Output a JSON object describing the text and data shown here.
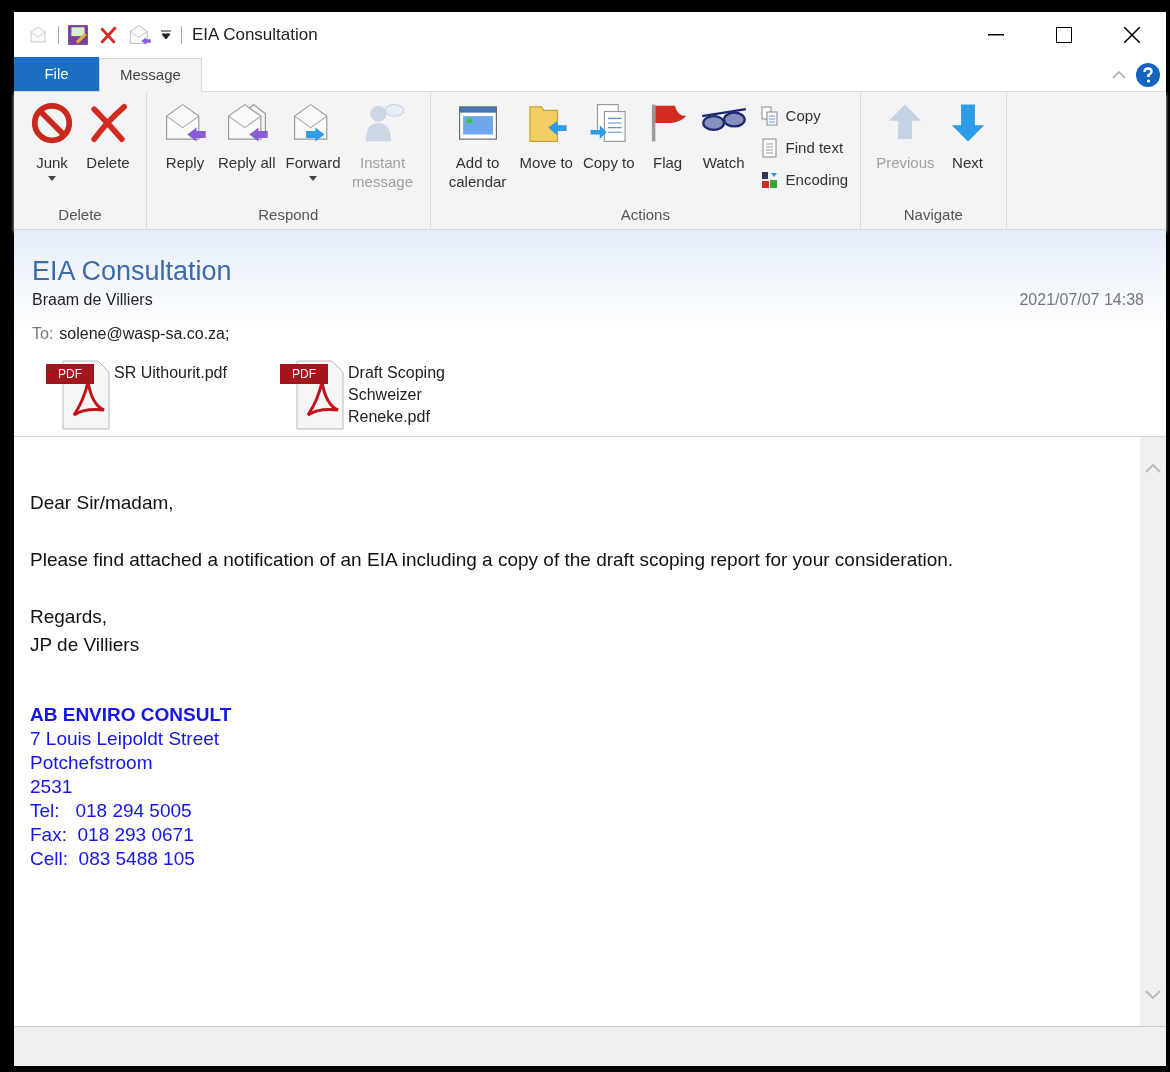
{
  "window": {
    "title": "EIA Consultation"
  },
  "tabs": [
    {
      "label": "File",
      "selected": false,
      "kind": "file"
    },
    {
      "label": "Message",
      "selected": true,
      "kind": "tab"
    }
  ],
  "ribbon": {
    "groups": [
      {
        "label": "Delete",
        "items": [
          {
            "kind": "large",
            "label": "Junk",
            "dropdown": true,
            "disabled": false
          },
          {
            "kind": "large",
            "label": "Delete",
            "dropdown": false,
            "disabled": false
          }
        ]
      },
      {
        "label": "Respond",
        "items": [
          {
            "kind": "large",
            "label": "Reply",
            "dropdown": false,
            "disabled": false
          },
          {
            "kind": "large",
            "label": "Reply all",
            "dropdown": false,
            "disabled": false
          },
          {
            "kind": "large",
            "label": "Forward",
            "dropdown": true,
            "disabled": false
          },
          {
            "kind": "large",
            "label": "Instant message",
            "dropdown": false,
            "disabled": true
          }
        ]
      },
      {
        "label": "Actions",
        "items": [
          {
            "kind": "large",
            "label": "Add to calendar",
            "dropdown": false,
            "disabled": false
          },
          {
            "kind": "large",
            "label": "Move to",
            "dropdown": false,
            "disabled": false
          },
          {
            "kind": "large",
            "label": "Copy to",
            "dropdown": false,
            "disabled": false
          },
          {
            "kind": "large",
            "label": "Flag",
            "dropdown": false,
            "disabled": false
          },
          {
            "kind": "large",
            "label": "Watch",
            "dropdown": false,
            "disabled": false
          },
          {
            "kind": "stack",
            "items": [
              {
                "label": "Copy",
                "disabled": false
              },
              {
                "label": "Find text",
                "disabled": false
              },
              {
                "label": "Encoding",
                "disabled": false
              }
            ]
          }
        ]
      },
      {
        "label": "Navigate",
        "items": [
          {
            "kind": "large",
            "label": "Previous",
            "dropdown": false,
            "disabled": true
          },
          {
            "kind": "large",
            "label": "Next",
            "dropdown": false,
            "disabled": false
          }
        ]
      }
    ]
  },
  "message": {
    "subject": "EIA Consultation",
    "sender": "Braam de Villiers",
    "date": "2021/07/07 14:38",
    "to_label": "To:",
    "to": "solene@wasp-sa.co.za;",
    "attachments": [
      {
        "badge": "PDF",
        "name": "SR Uithourit.pdf"
      },
      {
        "badge": "PDF",
        "name": "Draft Scoping Schweizer Reneke.pdf"
      }
    ],
    "body": [
      "Dear Sir/madam,",
      "Please find attached a notification of an EIA including a copy of the draft scoping report for your consideration.",
      "Regards,\nJP de Villiers"
    ],
    "signature": {
      "company": "AB ENVIRO CONSULT",
      "lines": [
        "7 Louis Leipoldt Street",
        "Potchefstroom",
        "2531",
        "Tel:   018 294 5005",
        "Fax:  018 293 0671",
        "Cell:  083 5488 105"
      ]
    }
  }
}
